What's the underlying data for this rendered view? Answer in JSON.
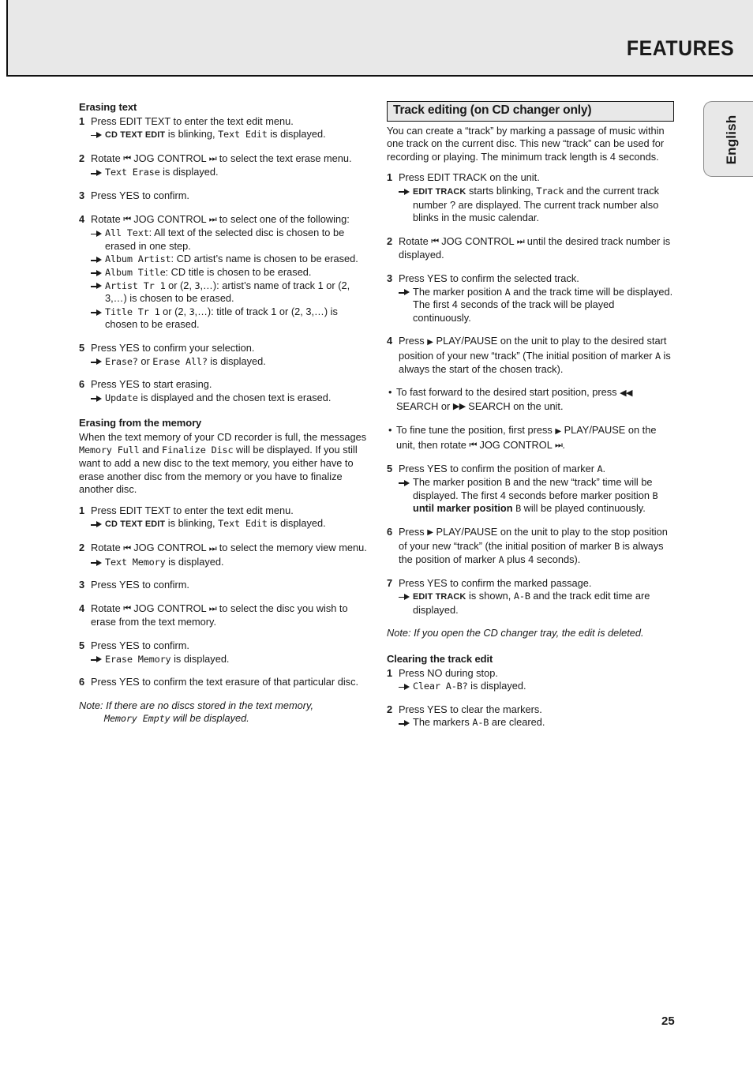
{
  "header": {
    "title": "FEATURES"
  },
  "language_tab": {
    "label": "English"
  },
  "page_number": "25",
  "glyphs": {
    "jog_left": "⏮",
    "jog_right": "⏭",
    "play": "▶",
    "search_back": "◀◀",
    "search_fwd": "▶▶",
    "bullet_dot": "•"
  },
  "left_column": {
    "section1": {
      "heading": "Erasing text",
      "steps": [
        {
          "num": "1",
          "text": "Press EDIT TEXT to enter the text edit menu.",
          "sub_pre": "",
          "sub_caps": "CD TEXT EDIT",
          "sub_mid": " is blinking, ",
          "sub_lcd": "Text Edit",
          "sub_post": " is displayed."
        },
        {
          "num": "2",
          "pre": "Rotate ",
          "mid": " JOG CONTROL ",
          "post": " to select the text erase menu.",
          "sub_lcd": "Text Erase",
          "sub_post": " is displayed."
        },
        {
          "num": "3",
          "text": "Press YES to confirm."
        },
        {
          "num": "4",
          "pre": "Rotate ",
          "mid": " JOG CONTROL ",
          "post": " to select one of the following:",
          "options": [
            {
              "lcd": "All Text",
              "text": ": All text of the selected disc is chosen to be erased in one step."
            },
            {
              "lcd": "Album Artist",
              "text": ": CD artist’s name is chosen to be erased."
            },
            {
              "lcd": "Album Title",
              "text": ": CD title is chosen to be erased."
            },
            {
              "lcd": "Artist Tr 1",
              "text": " or (2, ",
              "lcd2": "3",
              "text2": ",…): artist’s name of track 1 or (2, 3,…) is chosen to be erased."
            },
            {
              "lcd": "Title Tr 1",
              "text": " or (2, ",
              "lcd2": "3",
              "text2": ",…): title of track 1 or (2, 3,…) is chosen to be erased."
            }
          ]
        },
        {
          "num": "5",
          "text": "Press YES to confirm your selection.",
          "sub_lcd": "Erase?",
          "sub_mid": " or ",
          "sub_lcd2": "Erase All?",
          "sub_post": " is displayed."
        },
        {
          "num": "6",
          "text": "Press YES to start erasing.",
          "sub_lcd": "Update",
          "sub_post": " is displayed and the chosen text is erased."
        }
      ]
    },
    "section2": {
      "heading": "Erasing from the memory",
      "intro_a": "When the text memory of your CD recorder is full, the messages ",
      "intro_lcd1": "Memory Full",
      "intro_b": " and ",
      "intro_lcd2": "Finalize Disc",
      "intro_c": " will be displayed. If you still want to add a new disc to the text memory, you either have to erase another disc from the memory or you have to finalize another disc.",
      "steps": [
        {
          "num": "1",
          "text": "Press EDIT TEXT to enter the text edit menu.",
          "sub_caps": "CD TEXT EDIT",
          "sub_mid": " is blinking, ",
          "sub_lcd": "Text Edit",
          "sub_post": " is displayed."
        },
        {
          "num": "2",
          "pre": "Rotate ",
          "mid": " JOG CONTROL ",
          "post": " to select the memory view menu.",
          "sub_lcd": "Text Memory",
          "sub_post": " is displayed."
        },
        {
          "num": "3",
          "text": "Press YES to confirm."
        },
        {
          "num": "4",
          "pre": "Rotate ",
          "mid": " JOG CONTROL ",
          "post": " to select the disc you wish to erase from the text memory."
        },
        {
          "num": "5",
          "text": "Press YES to confirm.",
          "sub_lcd": "Erase Memory",
          "sub_post": " is displayed."
        },
        {
          "num": "6",
          "text": "Press YES to confirm the text erasure of that particular disc."
        }
      ],
      "note_a": "Note: If there are no discs stored in the text memory,",
      "note_lcd": "Memory Empty",
      "note_b": " will be displayed."
    }
  },
  "right_column": {
    "boxed_heading": "Track editing (on CD changer only)",
    "intro": "You can create a “track” by marking a passage of music within one track on the current disc. This new “track” can be used for recording or playing. The minimum track length is 4 seconds.",
    "steps": [
      {
        "num": "1",
        "text": "Press EDIT TRACK on the unit.",
        "sub_caps": "EDIT TRACK",
        "sub_mid": " starts blinking, ",
        "sub_lcd": "Track",
        "sub_post": " and the current track number ? are displayed. The current track number also blinks in the music calendar."
      },
      {
        "num": "2",
        "pre": "Rotate ",
        "mid": " JOG CONTROL ",
        "post": " until the desired track number is displayed."
      },
      {
        "num": "3",
        "text": "Press YES to confirm the selected track.",
        "sub_pre": "The marker position ",
        "sub_lcd": "A",
        "sub_post": " and the track time will be displayed. The first 4 seconds of the track will be played continuously."
      },
      {
        "num": "4",
        "pre": "Press ",
        "post": " PLAY/PAUSE on the unit to play to the desired start position of your new “track” (The initial position of marker ",
        "lcd_inline": "A",
        "post2": " is always the start of the chosen track)."
      }
    ],
    "bullets": [
      {
        "pre": "To fast forward to the desired start position, press ",
        "mid": " SEARCH or ",
        "post": " SEARCH on the unit."
      },
      {
        "pre": "To fine tune the position, first press ",
        "mid": " PLAY/PAUSE on the unit, then rotate ",
        "post": " JOG CONTROL ",
        "end": "."
      }
    ],
    "steps2": [
      {
        "num": "5",
        "pre": "Press YES to confirm the position of marker ",
        "lcd_inline": "A",
        "post": ".",
        "sub_pre": "The marker position ",
        "sub_lcd": "B",
        "sub_mid": " and the new “track” time will be displayed. The first 4 seconds before marker position ",
        "sub_lcd2": "B",
        "sub_bold": "until marker position",
        "sub_lcd3": "B",
        "sub_post": " will be played continuously."
      },
      {
        "num": "6",
        "pre": "Press ",
        "post": " PLAY/PAUSE on the unit to play to the stop position of your new “track” (the initial position of marker ",
        "lcd_inline": "B",
        "post2": " is always the position of marker ",
        "lcd_inline2": "A",
        "post3": " plus 4 seconds)."
      },
      {
        "num": "7",
        "text": "Press YES to confirm the marked passage.",
        "sub_caps": "EDIT TRACK",
        "sub_mid": " is shown, ",
        "sub_lcd": "A-B",
        "sub_post": " and the track edit time are displayed."
      }
    ],
    "note": "Note: If you open the CD changer tray, the edit is deleted.",
    "section_clear": {
      "heading": "Clearing the track edit",
      "steps": [
        {
          "num": "1",
          "text": "Press NO during stop.",
          "sub_lcd": "Clear A-B?",
          "sub_post": " is displayed."
        },
        {
          "num": "2",
          "text": "Press YES to clear the markers.",
          "sub_pre": "The markers ",
          "sub_lcd": "A-B",
          "sub_post": " are cleared."
        }
      ]
    }
  }
}
